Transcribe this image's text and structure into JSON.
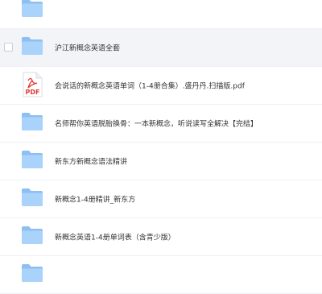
{
  "colors": {
    "folder_back": "#8ebff2",
    "folder_front": "#a9d3fa",
    "pdf_red": "#e03b32",
    "selected_row_bg": "#f3f4f7"
  },
  "files": [
    {
      "name": "",
      "icon": "folder-icon",
      "selected": false
    },
    {
      "name": "沪江新概念英语全套",
      "icon": "folder-icon",
      "selected": true
    },
    {
      "name": "会说话的新概念英语单词（1-4册合集）.盛丹丹.扫描版.pdf",
      "icon": "pdf-icon",
      "badge": "PDF",
      "selected": false
    },
    {
      "name": "名师帮你英语脱胎换骨：一本新概念，听说读写全解决【完结】",
      "icon": "folder-icon",
      "selected": false
    },
    {
      "name": "新东方新概念语法精讲",
      "icon": "folder-icon",
      "selected": false
    },
    {
      "name": "新概念1-4册精讲_新东方",
      "icon": "folder-icon",
      "selected": false
    },
    {
      "name": "新概念英语1-4册单词表（含青少版）",
      "icon": "folder-icon",
      "selected": false
    },
    {
      "name": "",
      "icon": "folder-icon",
      "selected": false
    }
  ]
}
